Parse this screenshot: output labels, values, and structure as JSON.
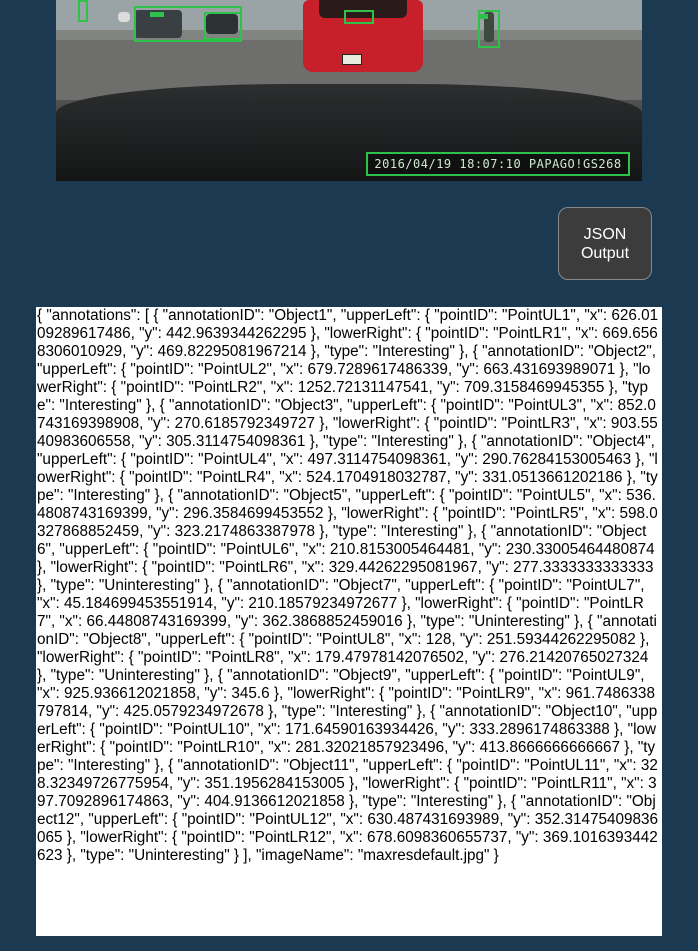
{
  "image": {
    "alt": "Dashcam road scene with annotated objects",
    "timestamp_overlay": "2016/04/19 18:07:10 PAPAGO!GS268"
  },
  "button": {
    "label": "JSON Output"
  },
  "output": {
    "text": "{ \"annotations\": [ { \"annotationID\": \"Object1\", \"upperLeft\": { \"pointID\": \"PointUL1\", \"x\": 626.0109289617486, \"y\": 442.9639344262295 }, \"lowerRight\": { \"pointID\": \"PointLR1\", \"x\": 669.6568306010929, \"y\": 469.82295081967214 }, \"type\": \"Interesting\" }, { \"annotationID\": \"Object2\", \"upperLeft\": { \"pointID\": \"PointUL2\", \"x\": 679.7289617486339, \"y\": 663.431693989071 }, \"lowerRight\": { \"pointID\": \"PointLR2\", \"x\": 1252.72131147541, \"y\": 709.3158469945355 }, \"type\": \"Interesting\" }, { \"annotationID\": \"Object3\", \"upperLeft\": { \"pointID\": \"PointUL3\", \"x\": 852.0743169398908, \"y\": 270.6185792349727 }, \"lowerRight\": { \"pointID\": \"PointLR3\", \"x\": 903.5540983606558, \"y\": 305.3114754098361 }, \"type\": \"Interesting\" }, { \"annotationID\": \"Object4\", \"upperLeft\": { \"pointID\": \"PointUL4\", \"x\": 497.3114754098361, \"y\": 290.76284153005463 }, \"lowerRight\": { \"pointID\": \"PointLR4\", \"x\": 524.1704918032787, \"y\": 331.0513661202186 }, \"type\": \"Interesting\" }, { \"annotationID\": \"Object5\", \"upperLeft\": { \"pointID\": \"PointUL5\", \"x\": 536.4808743169399, \"y\": 296.3584699453552 }, \"lowerRight\": { \"pointID\": \"PointLR5\", \"x\": 598.0327868852459, \"y\": 323.2174863387978 }, \"type\": \"Interesting\" }, { \"annotationID\": \"Object6\", \"upperLeft\": { \"pointID\": \"PointUL6\", \"x\": 210.8153005464481, \"y\": 230.33005464480874 }, \"lowerRight\": { \"pointID\": \"PointLR6\", \"x\": 329.44262295081967, \"y\": 277.3333333333333 }, \"type\": \"Uninteresting\" }, { \"annotationID\": \"Object7\", \"upperLeft\": { \"pointID\": \"PointUL7\", \"x\": 45.184699453551914, \"y\": 210.18579234972677 }, \"lowerRight\": { \"pointID\": \"PointLR7\", \"x\": 66.44808743169399, \"y\": 362.3868852459016 }, \"type\": \"Uninteresting\" }, { \"annotationID\": \"Object8\", \"upperLeft\": { \"pointID\": \"PointUL8\", \"x\": 128, \"y\": 251.59344262295082 }, \"lowerRight\": { \"pointID\": \"PointLR8\", \"x\": 179.47978142076502, \"y\": 276.21420765027324 }, \"type\": \"Uninteresting\" }, { \"annotationID\": \"Object9\", \"upperLeft\": { \"pointID\": \"PointUL9\", \"x\": 925.936612021858, \"y\": 345.6 }, \"lowerRight\": { \"pointID\": \"PointLR9\", \"x\": 961.7486338797814, \"y\": 425.0579234972678 }, \"type\": \"Interesting\" }, { \"annotationID\": \"Object10\", \"upperLeft\": { \"pointID\": \"PointUL10\", \"x\": 171.64590163934426, \"y\": 333.2896174863388 }, \"lowerRight\": { \"pointID\": \"PointLR10\", \"x\": 281.32021857923496, \"y\": 413.8666666666667 }, \"type\": \"Interesting\" }, { \"annotationID\": \"Object11\", \"upperLeft\": { \"pointID\": \"PointUL11\", \"x\": 328.32349726775954, \"y\": 351.1956284153005 }, \"lowerRight\": { \"pointID\": \"PointLR11\", \"x\": 397.7092896174863, \"y\": 404.9136612021858 }, \"type\": \"Interesting\" }, { \"annotationID\": \"Object12\", \"upperLeft\": { \"pointID\": \"PointUL12\", \"x\": 630.487431693989, \"y\": 352.31475409836065 }, \"lowerRight\": { \"pointID\": \"PointLR12\", \"x\": 678.6098360655737, \"y\": 369.1016393442623 }, \"type\": \"Uninteresting\" } ], \"imageName\": \"maxresdefault.jpg\" }"
  },
  "colors": {
    "page_background": "#1b3a52",
    "annotation_box": "#2ec24a",
    "button_background": "#3c3c3c"
  }
}
